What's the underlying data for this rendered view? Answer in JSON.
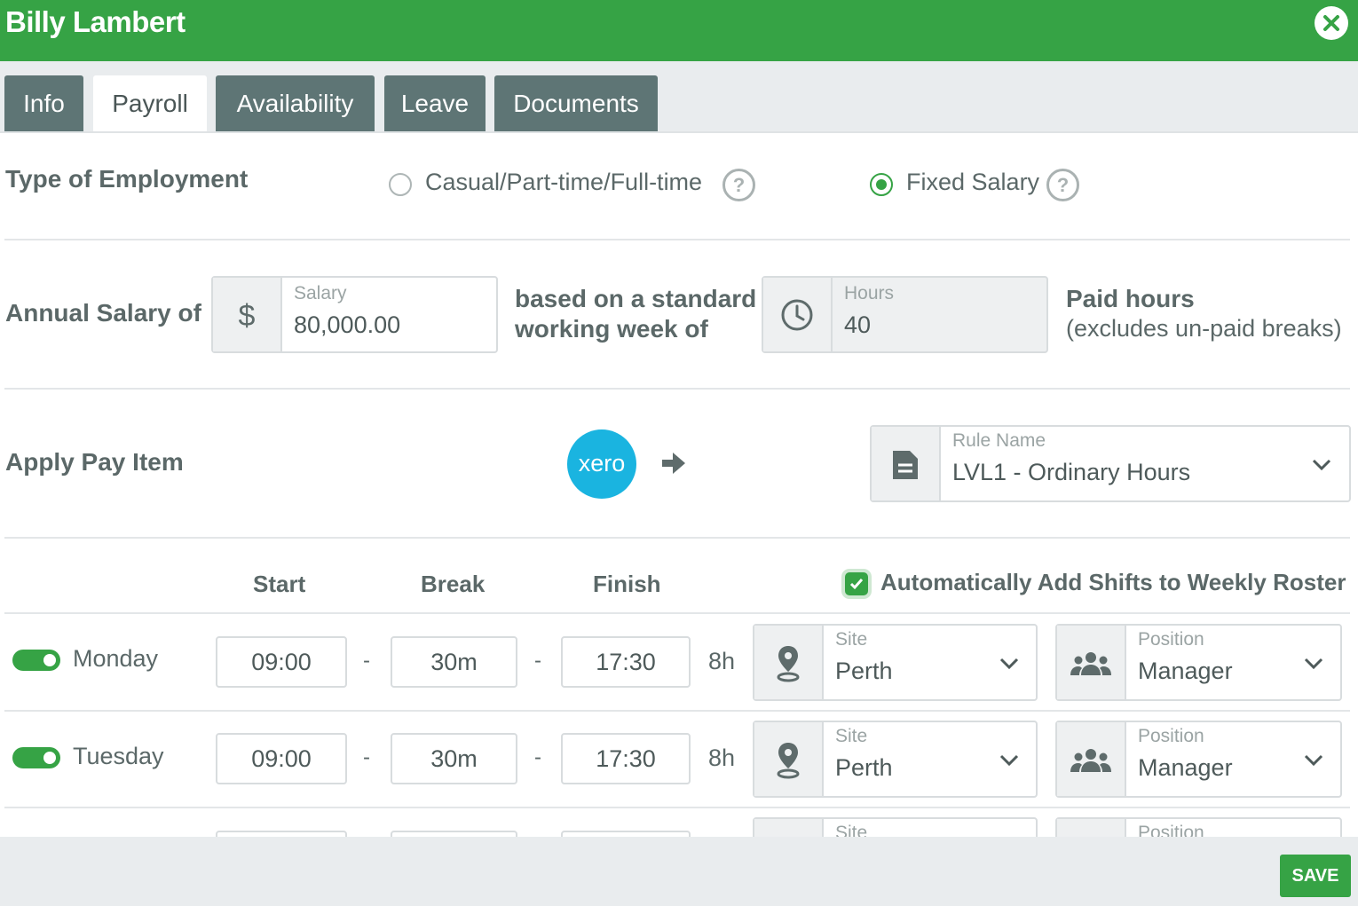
{
  "header": {
    "title": "Billy Lambert"
  },
  "tabs": [
    {
      "label": "Info",
      "active": false
    },
    {
      "label": "Payroll",
      "active": true
    },
    {
      "label": "Availability",
      "active": false
    },
    {
      "label": "Leave",
      "active": false
    },
    {
      "label": "Documents",
      "active": false
    }
  ],
  "employment": {
    "label": "Type of Employment",
    "options": [
      {
        "label": "Casual/Part-time/Full-time",
        "checked": false
      },
      {
        "label": "Fixed Salary",
        "checked": true
      }
    ],
    "help_glyph": "?"
  },
  "salary": {
    "label": "Annual Salary of",
    "salary_field_label": "Salary",
    "salary_value": "80,000.00",
    "middle_text_1": "based on a standard",
    "middle_text_2": "working week of",
    "hours_field_label": "Hours",
    "hours_value": "40",
    "paid_hours_title": "Paid hours",
    "paid_hours_note": "(excludes un-paid breaks)"
  },
  "pay_item": {
    "label": "Apply Pay Item",
    "xero_logo_text": "xero",
    "rule_label": "Rule Name",
    "rule_value": "LVL1 - Ordinary Hours"
  },
  "roster": {
    "col_start": "Start",
    "col_break": "Break",
    "col_finish": "Finish",
    "auto_add_label": "Automatically Add Shifts to Weekly Roster",
    "auto_add_checked": true,
    "separator": "-",
    "site_label": "Site",
    "position_label": "Position",
    "days": [
      {
        "day": "Monday",
        "enabled": true,
        "start": "09:00",
        "break": "30m",
        "finish": "17:30",
        "hours": "8h",
        "site": "Perth",
        "position": "Manager"
      },
      {
        "day": "Tuesday",
        "enabled": true,
        "start": "09:00",
        "break": "30m",
        "finish": "17:30",
        "hours": "8h",
        "site": "Perth",
        "position": "Manager"
      }
    ]
  },
  "footer": {
    "save_label": "SAVE"
  },
  "colors": {
    "brand_green": "#36a345",
    "tab_dark": "#5e7575",
    "xero_blue": "#1ab4e0"
  }
}
